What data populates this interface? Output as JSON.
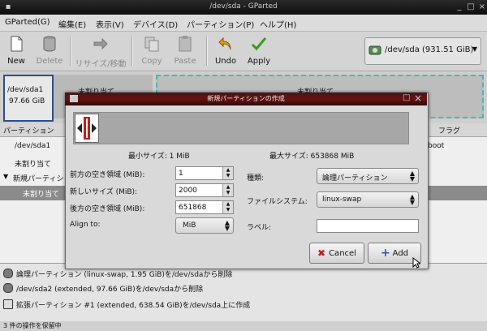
{
  "window": {
    "title": "/dev/sda - GParted"
  },
  "menu": [
    "GParted(G)",
    "編集(E)",
    "表示(V)",
    "デバイス(D)",
    "パーティション(P)",
    "ヘルプ(H)"
  ],
  "toolbar": {
    "new": "New",
    "delete": "Delete",
    "resize": "リサイズ/移動",
    "copy": "Copy",
    "paste": "Paste",
    "undo": "Undo",
    "apply": "Apply",
    "device": "/dev/sda  (931.51 GiB)"
  },
  "map": {
    "p1_name": "/dev/sda1",
    "p1_size": "97.66 GiB",
    "p2_label": "未割り当て",
    "p3_label": "未割り当て"
  },
  "table": {
    "col_partition": "パーティション",
    "col_flags": "フラグ",
    "rows": [
      "/dev/sda1",
      "未割り当て",
      "新規パーティション",
      "未割り当て"
    ],
    "boot_flag": "boot"
  },
  "log": [
    "論理パーティション (linux-swap, 1.95 GiB)を/dev/sdaから削除",
    "/dev/sda2 (extended, 97.66 GiB)を/dev/sdaから削除",
    "拡張パーティション #1 (extended, 638.54 GiB)を/dev/sda上に作成"
  ],
  "status": "3 件の操作を保留中",
  "dialog": {
    "title": "新規パーティションの作成",
    "min_size_label": "最小サイズ: 1 MiB",
    "max_size_label": "最大サイズ: 653868 MiB",
    "free_before_label": "前方の空き領域 (MiB):",
    "free_before_value": "1",
    "new_size_label": "新しいサイズ (MiB):",
    "new_size_value": "2000",
    "free_after_label": "後方の空き領域 (MiB):",
    "free_after_value": "651868",
    "align_label": "Align to:",
    "align_value": "MiB",
    "type_label": "種類:",
    "type_value": "論理パーティション",
    "fs_label": "ファイルシステム:",
    "fs_value": "linux-swap",
    "label_label": "ラベル:",
    "label_value": "",
    "cancel": "Cancel",
    "add": "Add"
  },
  "colors": {
    "accent": "#2b4f8a",
    "unallocated_border": "#4fb3b3",
    "handle": "#c0201c",
    "dialog_title": "#6a1010"
  }
}
